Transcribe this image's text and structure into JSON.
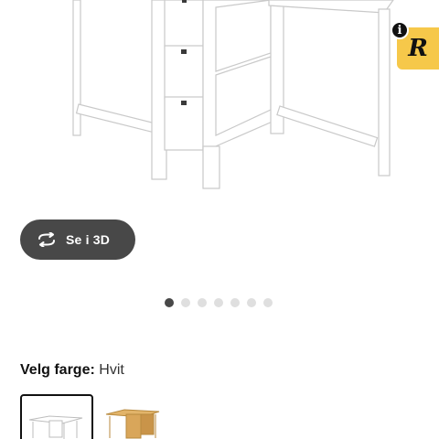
{
  "product_image": {
    "icon": "drop-leaf-table-white-image"
  },
  "badge": {
    "info_glyph": "i",
    "mark": "R",
    "color": "#f6c84a"
  },
  "view_3d_button": {
    "label": "Se i 3D",
    "icon": "rotate-3d-icon"
  },
  "carousel": {
    "count": 7,
    "active_index": 0
  },
  "color_selector": {
    "label": "Velg farge:",
    "value": "Hvit",
    "swatches": [
      {
        "icon": "white-table-swatch",
        "selected": true
      },
      {
        "icon": "birch-table-swatch",
        "selected": false
      }
    ]
  },
  "colors": {
    "accent_dark": "#484848",
    "dot_inactive": "#dfdfdf"
  }
}
